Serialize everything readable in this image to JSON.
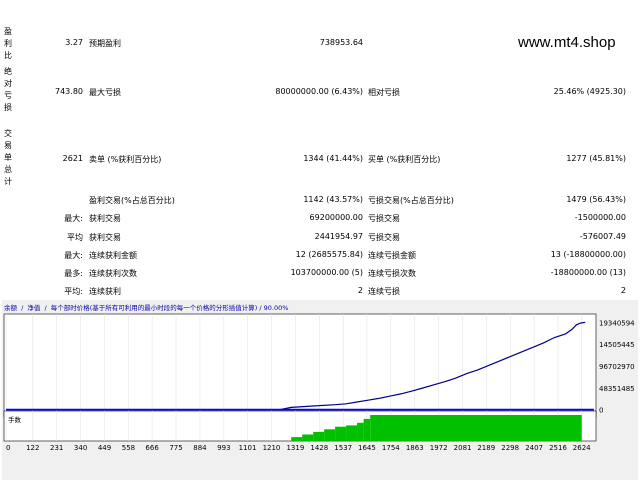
{
  "watermark": "www.mt4.shop",
  "side_labels": {
    "profit_factor": "盈利比",
    "absolute_drawdown": "绝对亏损",
    "total_trades": "交易单总计"
  },
  "stats": {
    "r1_val": "3.27",
    "r1_label2": "预期盈利",
    "r1_val2": "738953.64",
    "r2_val": "743.80",
    "r2_label2": "最大亏损",
    "r2_val2": "80000000.00 (6.43%)",
    "r2_label3": "相对亏损",
    "r2_val3": "25.46% (4925.30)",
    "r3_val": "2621",
    "r3_label2": "卖单 (%获利百分比)",
    "r3_val2": "1344 (41.44%)",
    "r3_label3": "买单 (%获利百分比)",
    "r3_val3": "1277 (45.81%)",
    "r4_label2": "盈利交易(%占总百分比)",
    "r4_val2": "1142 (43.57%)",
    "r4_label3": "亏损交易(%占总百分比)",
    "r4_val3": "1479 (56.43%)",
    "r5_label1": "最大:",
    "r5_label2": "获利交易",
    "r5_val2": "69200000.00",
    "r5_label3": "亏损交易",
    "r5_val3": "-1500000.00",
    "r6_label1": "平均",
    "r6_label2": "获利交易",
    "r6_val2": "2441954.97",
    "r6_label3": "亏损交易",
    "r6_val3": "-576007.49",
    "r7_label1": "最大:",
    "r7_label2": "连续获利金额",
    "r7_val2": "12 (2685575.84)",
    "r7_label3": "连续亏损金额",
    "r7_val3": "13 (-18800000.00)",
    "r8_label1": "最多:",
    "r8_label2": "连续获利次数",
    "r8_val2": "103700000.00 (5)",
    "r8_label3": "连续亏损次数",
    "r8_val3": "-18800000.00 (13)",
    "r9_label1": "平均:",
    "r9_label2": "连续获利",
    "r9_val2": "2",
    "r9_label3": "连续亏损",
    "r9_val3": "2"
  },
  "graph": {
    "tab_balance": "余额",
    "tab_equity": "净值",
    "caption": "每个部时价格(基于所有可利用的最小时段的每一个价格的分形插值计算) / 90.00%",
    "lots_label": "手数"
  },
  "chart_data": {
    "type": "line",
    "title": "",
    "xlabel": "",
    "ylabel": "",
    "x_ticks": [
      0,
      122,
      231,
      340,
      449,
      558,
      666,
      775,
      884,
      993,
      1101,
      1210,
      1319,
      1428,
      1537,
      1645,
      1754,
      1863,
      1972,
      2081,
      2189,
      2298,
      2407,
      2516,
      2624
    ],
    "y_ticks": [
      0,
      48351485,
      96702970,
      145054455,
      193405940
    ],
    "y_tick_labels": [
      "0",
      "48351485",
      "96702970",
      "14505445",
      "19340594"
    ],
    "xlim": [
      0,
      2680
    ],
    "ylim": [
      -3000000,
      212000000
    ],
    "colors": {
      "balance": "#00008b",
      "equity": "#00008b",
      "lots": "#00c000",
      "zero_line": "#0000ff"
    },
    "series": [
      {
        "x": [
          0,
          1000,
          1250,
          1300,
          1400,
          1500,
          1550,
          1600,
          1650,
          1700,
          1750,
          1800,
          1850,
          1900,
          1950,
          2000,
          2050,
          2100,
          2150,
          2200,
          2250,
          2300,
          2350,
          2400,
          2450,
          2500,
          2550,
          2580,
          2600,
          2620,
          2640
        ],
        "y": [
          0,
          0,
          0,
          5000000,
          8000000,
          11000000,
          13000000,
          17000000,
          21000000,
          25000000,
          30000000,
          35000000,
          41000000,
          48000000,
          55000000,
          62000000,
          70000000,
          80000000,
          88000000,
          98000000,
          108000000,
          118000000,
          128000000,
          138000000,
          148000000,
          160000000,
          168000000,
          178000000,
          188000000,
          192000000,
          193400000
        ]
      }
    ],
    "lots": [
      {
        "x": 1300,
        "v": 0.15
      },
      {
        "x": 1350,
        "v": 0.25
      },
      {
        "x": 1400,
        "v": 0.35
      },
      {
        "x": 1450,
        "v": 0.45
      },
      {
        "x": 1500,
        "v": 0.55
      },
      {
        "x": 1550,
        "v": 0.6
      },
      {
        "x": 1600,
        "v": 0.7
      },
      {
        "x": 1630,
        "v": 0.85
      },
      {
        "x": 1660,
        "v": 1.0
      },
      {
        "x": 1700,
        "v": 1.0
      },
      {
        "x": 2624,
        "v": 1.0
      }
    ]
  }
}
